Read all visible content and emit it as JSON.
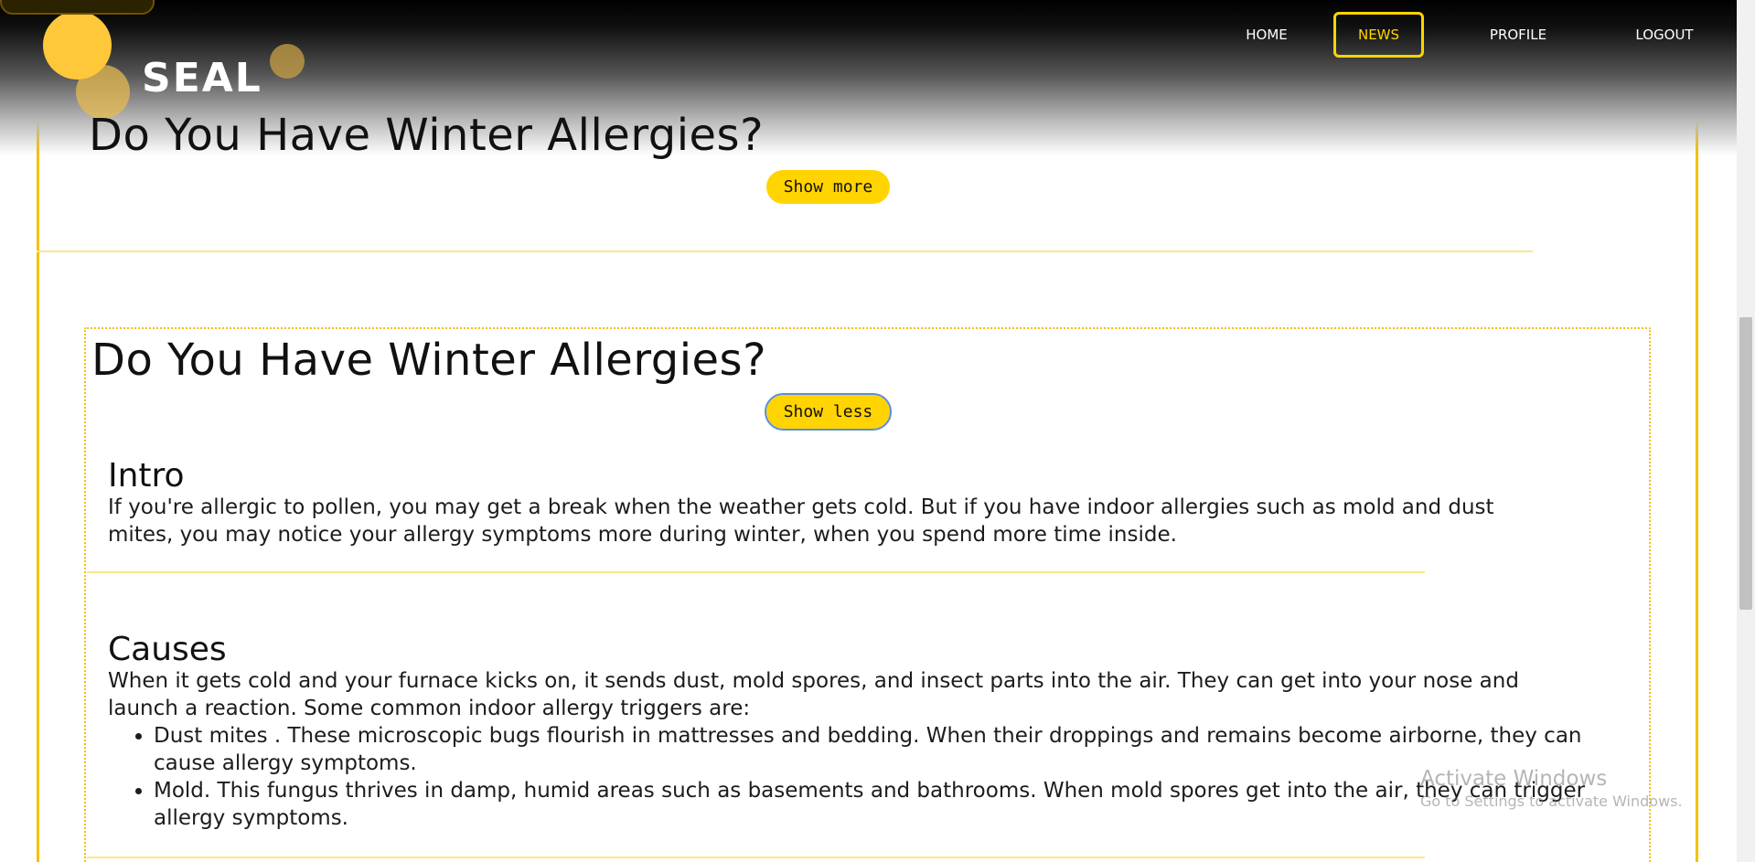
{
  "brand": {
    "name": "SEAL"
  },
  "nav": {
    "items": [
      {
        "label": "HOME"
      },
      {
        "label": "NEWS"
      },
      {
        "label": "PROFILE"
      },
      {
        "label": "LOGOUT"
      }
    ],
    "active": "NEWS",
    "accent_color": "#ffd400"
  },
  "articles": [
    {
      "title": "Do You Have Winter Allergies?",
      "toggle_label": "Show more"
    },
    {
      "title": "Do You Have Winter Allergies?",
      "toggle_label": "Show less",
      "sections": {
        "intro": {
          "heading": "Intro",
          "text": "If you're allergic to pollen, you may get a break when the weather gets cold. But if you have indoor allergies such as mold and dust mites, you may notice your allergy symptoms more during winter, when you spend more time inside."
        },
        "causes": {
          "heading": "Causes",
          "text": "When it gets cold and your furnace kicks on, it sends dust, mold spores, and insect parts into the air. They can get into your nose and launch a reaction. Some common indoor allergy triggers are:",
          "list": [
            "Dust mites . These microscopic bugs flourish in mattresses and bedding. When their droppings and remains become airborne, they can cause allergy symptoms.",
            "Mold. This fungus thrives in damp, humid areas such as basements and bathrooms. When mold spores get into the air, they can trigger allergy symptoms."
          ]
        }
      }
    }
  ],
  "watermark": {
    "title": "Activate Windows",
    "subtitle": "Go to Settings to activate Windows."
  },
  "colors": {
    "frame": "#f2c200",
    "button": "#ffd400"
  }
}
